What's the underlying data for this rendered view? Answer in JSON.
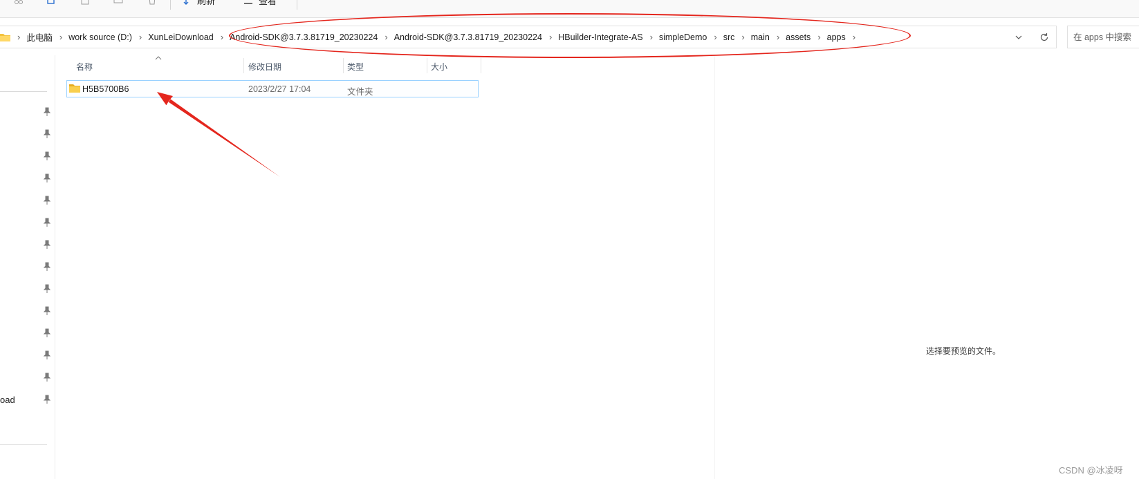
{
  "toolbar": {
    "refresh_label": "刷新",
    "view_label": "查看"
  },
  "address_bar": {
    "crumbs": [
      "此电脑",
      "work source (D:)",
      "XunLeiDownload",
      "Android-SDK@3.7.3.81719_20230224",
      "Android-SDK@3.7.3.81719_20230224",
      "HBuilder-Integrate-AS",
      "simpleDemo",
      "src",
      "main",
      "assets",
      "apps"
    ],
    "separator": "›"
  },
  "search": {
    "placeholder": "在 apps 中搜索"
  },
  "columns": {
    "name": "名称",
    "modified": "修改日期",
    "type": "类型",
    "size": "大小"
  },
  "files": [
    {
      "name": "H5B5700B6",
      "modified": "2023/2/27 17:04",
      "type": "文件夹",
      "size": ""
    }
  ],
  "nav": {
    "partial_label": "oad"
  },
  "preview": {
    "empty_message": "选择要预览的文件。"
  },
  "watermark": "CSDN @冰凌呀",
  "colors": {
    "annotation": "#e4261d",
    "selection_border": "#99d1ff",
    "folder": "#f4c23d",
    "header_text": "#4d5a6b"
  },
  "icons": {
    "toolbar": [
      "cut-icon",
      "copy-icon",
      "paste-icon",
      "rename-icon",
      "delete-icon",
      "refresh-icon",
      "view-icon"
    ],
    "address": [
      "this-pc-folder-icon",
      "chevron-down-icon",
      "reload-icon"
    ],
    "nav": "pin-icon",
    "file": "folder-icon"
  }
}
